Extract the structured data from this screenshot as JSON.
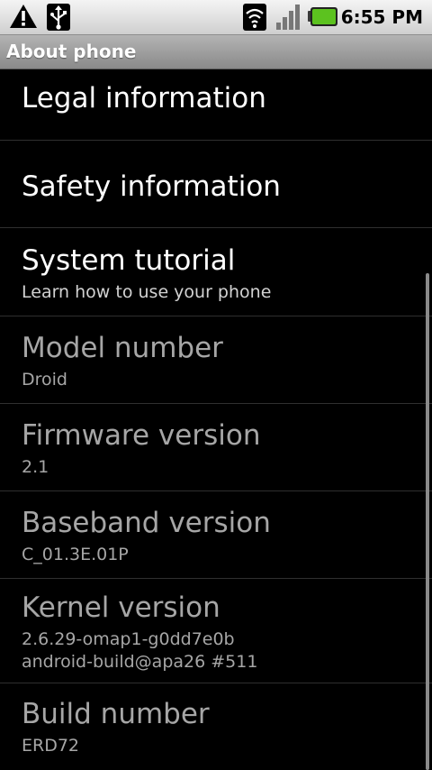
{
  "status_bar": {
    "time": "6:55 PM",
    "icons": [
      "warning-icon",
      "usb-icon",
      "wifi-icon",
      "signal-icon",
      "battery-icon"
    ]
  },
  "title_bar": {
    "title": "About phone"
  },
  "list": {
    "items": [
      {
        "title": "Legal information",
        "enabled": true
      },
      {
        "title": "Safety information",
        "enabled": true
      },
      {
        "title": "System tutorial",
        "summary": "Learn how to use your phone",
        "enabled": true
      },
      {
        "title": "Model number",
        "summary": "Droid",
        "enabled": false
      },
      {
        "title": "Firmware version",
        "summary": "2.1",
        "enabled": false
      },
      {
        "title": "Baseband version",
        "summary": "C_01.3E.01P",
        "enabled": false
      },
      {
        "title": "Kernel version",
        "summary": "2.6.29-omap1-g0dd7e0b",
        "summary_line2": "android-build@apa26 #511",
        "enabled": false
      },
      {
        "title": "Build number",
        "summary": "ERD72",
        "enabled": false
      }
    ]
  },
  "colors": {
    "background": "#000000",
    "enabled_text": "#ffffff",
    "disabled_text": "#a6a6a6",
    "battery": "#5cc21f"
  }
}
